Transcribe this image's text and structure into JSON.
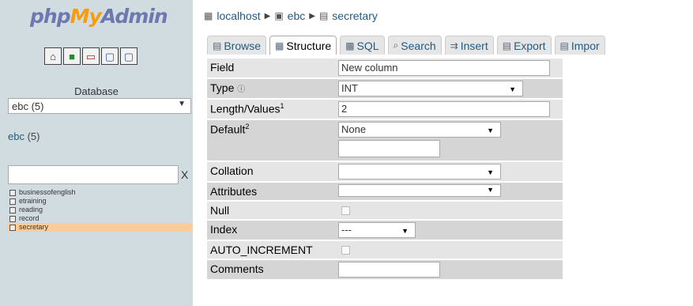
{
  "app": {
    "logo_parts": [
      "php",
      "My",
      "Admin"
    ]
  },
  "sidebar": {
    "nav_icons": [
      "home-icon",
      "sql-icon",
      "query-icon",
      "docs-icon",
      "settings-icon"
    ],
    "database_label": "Database",
    "database_select": "ebc (5)",
    "db_name": "ebc",
    "db_count": " (5)",
    "filter_placeholder": "",
    "filter_clear": "X",
    "tables": [
      {
        "name": "businessofenglish"
      },
      {
        "name": "etraining"
      },
      {
        "name": "reading"
      },
      {
        "name": "record"
      },
      {
        "name": "secretary",
        "active": true
      }
    ]
  },
  "breadcrumb": {
    "server": "localhost",
    "database": "ebc",
    "table": "secretary"
  },
  "tabs": [
    {
      "label": "Browse",
      "icon": "browse-icon"
    },
    {
      "label": "Structure",
      "icon": "structure-icon",
      "active": true
    },
    {
      "label": "SQL",
      "icon": "sql-icon"
    },
    {
      "label": "Search",
      "icon": "search-icon"
    },
    {
      "label": "Insert",
      "icon": "insert-icon"
    },
    {
      "label": "Export",
      "icon": "export-icon"
    },
    {
      "label": "Impor",
      "icon": "import-icon"
    }
  ],
  "form": {
    "field_label": "Field",
    "field_value": "New column",
    "type_label": "Type",
    "type_help_icon": "help-icon",
    "type_value": "INT",
    "length_label": "Length/Values",
    "length_sup": "1",
    "length_value": "2",
    "default_label": "Default",
    "default_sup": "2",
    "default_value": "None",
    "default_extra_value": "",
    "collation_label": "Collation",
    "collation_value": "",
    "attributes_label": "Attributes",
    "attributes_value": "",
    "null_label": "Null",
    "null_checked": false,
    "index_label": "Index",
    "index_value": "---",
    "ai_label": "AUTO_INCREMENT",
    "ai_checked": false,
    "comments_label": "Comments",
    "comments_value": ""
  },
  "colors": {
    "sidebar_bg": "#d0dce0",
    "link": "#235a81",
    "active_table": "#ffcc99"
  }
}
